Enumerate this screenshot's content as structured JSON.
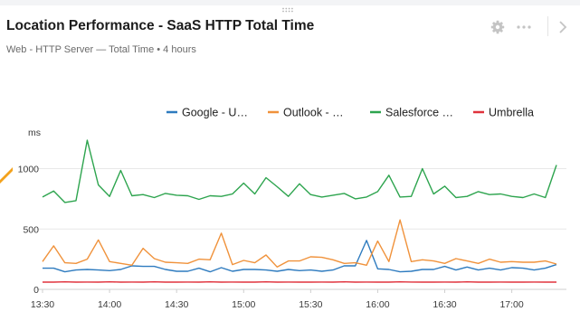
{
  "widget": {
    "title": "Location Performance - SaaS HTTP Total Time",
    "subtitle": "Web - HTTP Server — Total Time • 4 hours"
  },
  "toolbar": {
    "settings_icon": "gear-icon",
    "more_icon": "more-horizontal-icon",
    "next_icon": "chevron-right-icon"
  },
  "chart_data": {
    "type": "line",
    "ylabel": "ms",
    "yticks": [
      0,
      500,
      1000
    ],
    "ylim": [
      0,
      1200
    ],
    "xticks": [
      "13:30",
      "14:00",
      "14:30",
      "15:00",
      "15:30",
      "16:00",
      "16:30",
      "17:00"
    ],
    "grid": "horizontal",
    "legend": "top",
    "x": [
      "13:30",
      "13:35",
      "13:40",
      "13:45",
      "13:50",
      "13:55",
      "14:00",
      "14:05",
      "14:10",
      "14:15",
      "14:20",
      "14:25",
      "14:30",
      "14:35",
      "14:40",
      "14:45",
      "14:50",
      "14:55",
      "15:00",
      "15:05",
      "15:10",
      "15:15",
      "15:20",
      "15:25",
      "15:30",
      "15:35",
      "15:40",
      "15:45",
      "15:50",
      "15:55",
      "16:00",
      "16:05",
      "16:10",
      "16:15",
      "16:20",
      "16:25",
      "16:30",
      "16:35",
      "16:40",
      "16:45",
      "16:50",
      "16:55",
      "17:00",
      "17:05",
      "17:10",
      "17:15",
      "17:20"
    ],
    "series": [
      {
        "name": "Google - U…",
        "color": "#2e7bbf",
        "values": [
          175,
          175,
          145,
          160,
          165,
          160,
          155,
          165,
          195,
          190,
          190,
          165,
          150,
          150,
          175,
          145,
          180,
          150,
          165,
          165,
          160,
          150,
          165,
          155,
          160,
          150,
          160,
          195,
          195,
          405,
          170,
          165,
          145,
          150,
          165,
          165,
          190,
          160,
          185,
          160,
          175,
          160,
          180,
          175,
          160,
          175,
          205
        ]
      },
      {
        "name": "Outlook - …",
        "color": "#f0923b",
        "values": [
          230,
          360,
          220,
          215,
          250,
          410,
          230,
          215,
          200,
          340,
          255,
          225,
          220,
          215,
          250,
          245,
          465,
          205,
          240,
          220,
          285,
          185,
          235,
          235,
          270,
          265,
          245,
          215,
          220,
          200,
          400,
          230,
          575,
          230,
          245,
          235,
          215,
          255,
          235,
          215,
          250,
          225,
          230,
          225,
          225,
          235,
          210
        ]
      },
      {
        "name": "Salesforce …",
        "color": "#2da44e",
        "values": [
          765,
          815,
          720,
          735,
          1235,
          865,
          770,
          985,
          775,
          785,
          760,
          795,
          780,
          775,
          745,
          775,
          770,
          790,
          880,
          790,
          925,
          850,
          770,
          875,
          785,
          765,
          780,
          795,
          750,
          765,
          810,
          945,
          765,
          770,
          1000,
          790,
          855,
          760,
          770,
          810,
          785,
          790,
          770,
          760,
          790,
          760,
          1030
        ]
      },
      {
        "name": "Umbrella",
        "color": "#e0323c",
        "values": [
          60,
          60,
          62,
          60,
          61,
          60,
          62,
          60,
          61,
          60,
          62,
          60,
          60,
          61,
          60,
          62,
          60,
          61,
          60,
          60,
          62,
          60,
          61,
          60,
          60,
          61,
          60,
          62,
          60,
          61,
          60,
          60,
          62,
          61,
          60,
          60,
          61,
          60,
          62,
          60,
          60,
          61,
          60,
          60,
          61,
          60,
          60
        ]
      }
    ]
  }
}
